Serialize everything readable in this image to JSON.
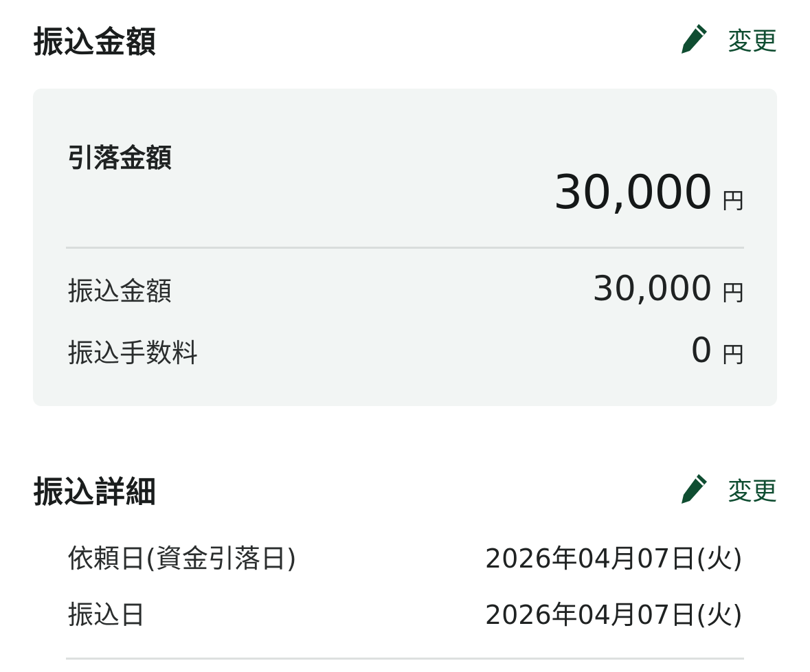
{
  "transfer_amount_section": {
    "title": "振込金額",
    "edit_label": "変更"
  },
  "amount_card": {
    "debit_label": "引落金額",
    "debit_value": "30,000",
    "debit_unit": "円",
    "rows": [
      {
        "label": "振込金額",
        "value": "30,000",
        "unit": "円"
      },
      {
        "label": "振込手数料",
        "value": "0",
        "unit": "円"
      }
    ]
  },
  "transfer_details_section": {
    "title": "振込詳細",
    "edit_label": "変更",
    "rows": [
      {
        "label": "依頼日(資金引落日)",
        "value": "2026年04月07日(火)"
      },
      {
        "label": "振込日",
        "value": "2026年04月07日(火)"
      }
    ]
  },
  "colors": {
    "accent": "#0f4d31",
    "card_background": "#f2f5f4"
  },
  "icons": {
    "edit": "pencil-icon"
  }
}
